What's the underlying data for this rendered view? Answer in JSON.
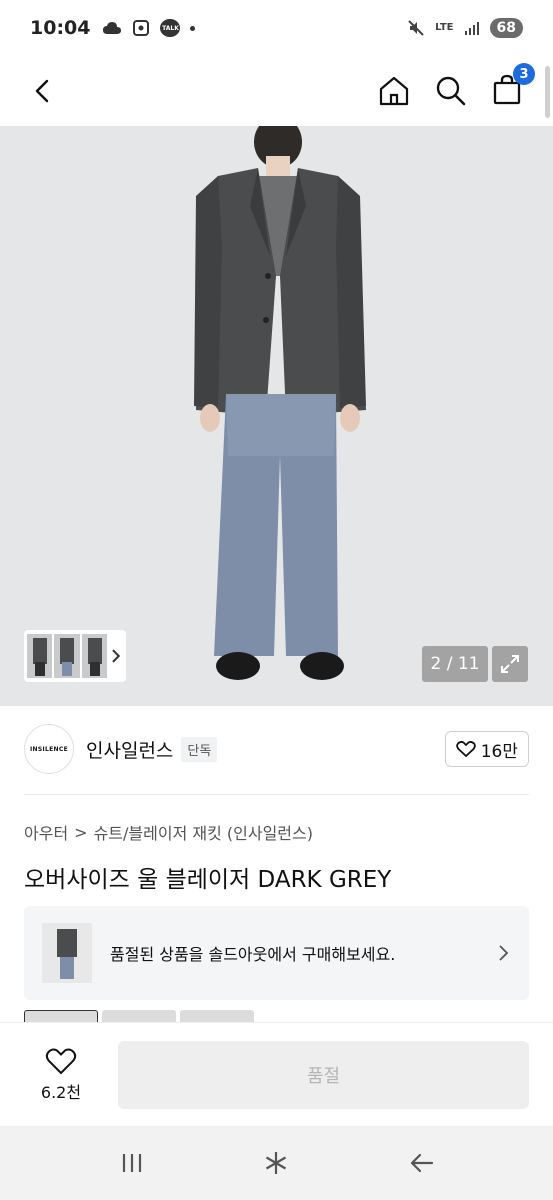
{
  "status_bar": {
    "time": "10:04",
    "talk_label": "TALK",
    "network": "LTE",
    "battery": "68"
  },
  "top_nav": {
    "cart_count": "3"
  },
  "gallery": {
    "counter": "2 / 11"
  },
  "brand": {
    "logo_text": "INSILENCE",
    "name": "인사일런스",
    "tag": "단독",
    "likes": "16만"
  },
  "breadcrumb": {
    "category": "아우터",
    "separator": ">",
    "subcategory": "슈트/블레이저 재킷 (인사일런스)"
  },
  "product": {
    "title": "오버사이즈 울 블레이저 DARK GREY"
  },
  "soldout_banner": {
    "text": "품절된 상품을 솔드아웃에서 구매해보세요."
  },
  "action_bar": {
    "wish_count": "6.2천",
    "buy_label": "품절"
  },
  "colors": {
    "accent": "#1e6bdc",
    "jacket": "#4a4c4e",
    "jeans": "#7f8ea8",
    "background": "#e5e6e8"
  }
}
